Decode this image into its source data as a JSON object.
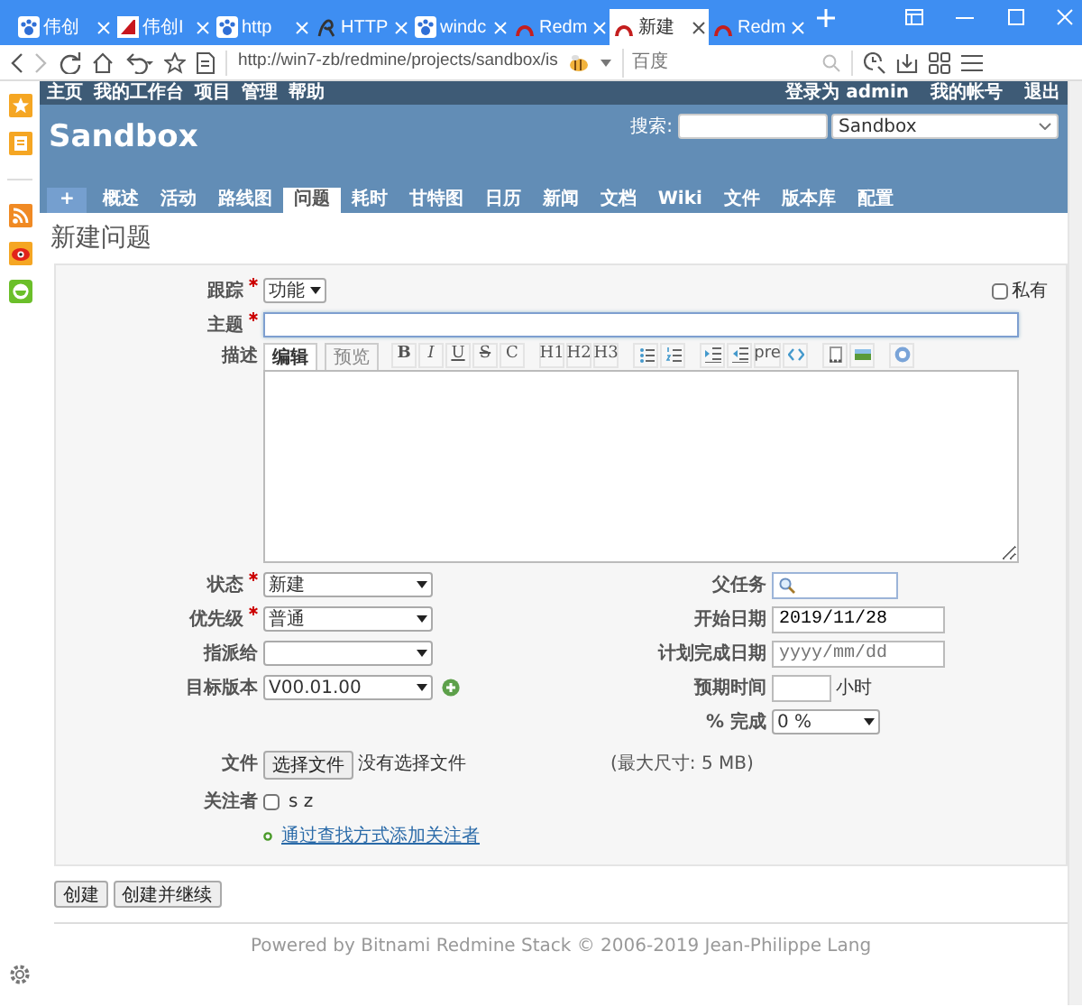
{
  "browser": {
    "tabs": [
      {
        "title": "伟创",
        "kind": "paw",
        "selected": false
      },
      {
        "title": "伟创I",
        "kind": "mark",
        "selected": false
      },
      {
        "title": "http",
        "kind": "paw",
        "selected": false
      },
      {
        "title": "HTTP",
        "kind": "glyph",
        "selected": false
      },
      {
        "title": "windc",
        "kind": "paw",
        "selected": false
      },
      {
        "title": "Redm",
        "kind": "arc",
        "selected": false
      },
      {
        "title": "新建",
        "kind": "arc",
        "selected": true
      },
      {
        "title": "Redm",
        "kind": "arc",
        "selected": false
      }
    ],
    "address": "http://win7-zb/redmine/projects/sandbox/is",
    "search": {
      "placeholder": "百度"
    }
  },
  "top_menu": {
    "items": [
      "主页",
      "我的工作台",
      "项目",
      "管理",
      "帮助"
    ],
    "account": [
      "登录为 **admin**",
      "我的帐号",
      "退出"
    ]
  },
  "header": {
    "title": "Sandbox",
    "search_label": "搜索:",
    "project": "Sandbox"
  },
  "main_menu": [
    {
      "label": "+",
      "kind": "new",
      "selected": false
    },
    {
      "label": "概述",
      "selected": false
    },
    {
      "label": "活动",
      "selected": false
    },
    {
      "label": "路线图",
      "selected": false
    },
    {
      "label": "问题",
      "selected": true
    },
    {
      "label": "耗时",
      "selected": false
    },
    {
      "label": "甘特图",
      "selected": false
    },
    {
      "label": "日历",
      "selected": false
    },
    {
      "label": "新闻",
      "selected": false
    },
    {
      "label": "文档",
      "selected": false
    },
    {
      "label": "Wiki",
      "selected": false
    },
    {
      "label": "文件",
      "selected": false
    },
    {
      "label": "版本库",
      "selected": false
    },
    {
      "label": "配置",
      "selected": false
    }
  ],
  "page_title": "新建问题",
  "form": {
    "tracker": {
      "label": "跟踪",
      "required": true,
      "value": "功能"
    },
    "private": {
      "label": "私有",
      "checked": false
    },
    "subject": {
      "label": "主题",
      "required": true
    },
    "description": {
      "label": "描述",
      "tabs": [
        {
          "label": "编辑",
          "selected": true
        },
        {
          "label": "预览",
          "selected": false
        }
      ],
      "toolbar": [
        [
          {
            "kind": "bold",
            "label": "B"
          },
          {
            "kind": "italic",
            "label": "I"
          },
          {
            "kind": "underline",
            "label": "U"
          },
          {
            "kind": "strike",
            "label": "S"
          },
          {
            "kind": "text",
            "label": "C"
          }
        ],
        [
          {
            "kind": "text",
            "label": "H1"
          },
          {
            "kind": "text",
            "label": "H2"
          },
          {
            "kind": "text",
            "label": "H3"
          }
        ],
        [
          {
            "kind": "bullets"
          },
          {
            "kind": "numbers"
          }
        ],
        [
          {
            "kind": "indent"
          },
          {
            "kind": "outdent"
          },
          {
            "kind": "text",
            "label": "pre"
          },
          {
            "kind": "code"
          }
        ],
        [
          {
            "kind": "link"
          },
          {
            "kind": "image"
          }
        ],
        [
          {
            "kind": "help"
          }
        ]
      ]
    },
    "left": [
      {
        "label": "状态",
        "required": true,
        "value": "新建"
      },
      {
        "label": "优先级",
        "required": true,
        "value": "普通"
      },
      {
        "label": "指派给",
        "required": false
      },
      {
        "label": "目标版本",
        "required": false,
        "value": "V00.01.00",
        "addable": true
      }
    ],
    "right": [
      {
        "label": "父任务",
        "kind": "search"
      },
      {
        "label": "开始日期",
        "kind": "date",
        "value": "2019/11/28"
      },
      {
        "label": "计划完成日期",
        "kind": "date",
        "placeholder": "yyyy/mm/dd"
      },
      {
        "label": "预期时间",
        "kind": "hours",
        "unit": "小时"
      },
      {
        "label": "% 完成",
        "kind": "select",
        "value": "0 %"
      }
    ],
    "files": {
      "label": "文件",
      "button": "选择文件",
      "status": "没有选择文件",
      "max_size": "(最大尺寸: 5 MB)"
    },
    "watchers": {
      "label": "关注者",
      "users": [
        {
          "name": "s z",
          "checked": false
        }
      ],
      "add_link": "通过查找方式添加关注者"
    }
  },
  "buttons": [
    "创建",
    "创建并继续"
  ],
  "footer": {
    "prefix": "Powered by",
    "link": "Bitnami Redmine Stack",
    "suffix": "© 2006-2019 Jean-Philippe Lang"
  }
}
